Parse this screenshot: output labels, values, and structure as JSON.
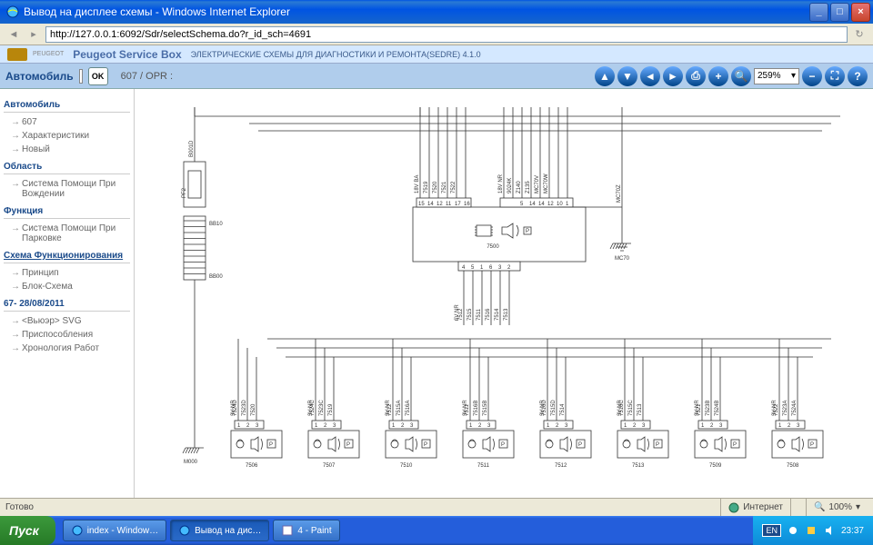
{
  "window": {
    "title": "Вывод на дисплее схемы - Windows Internet Explorer",
    "url": "http://127.0.0.1:6092/Sdr/selectSchema.do?r_id_sch=4691"
  },
  "header": {
    "brand": "Peugeot Service Box",
    "logo_label": "PEUGEOT",
    "subtitle": "ЭЛЕКТРИЧЕСКИЕ СХЕМЫ ДЛЯ ДИАГНОСТИКИ И РЕМОНТА(SEDRE) 4.1.0"
  },
  "toolbar": {
    "car_label": "Автомобиль",
    "ok": "OK",
    "breadcrumb": "607  /  OPR :",
    "zoom": "259%"
  },
  "sidebar": {
    "s1": "Автомобиль",
    "s1_items": [
      "607",
      "Характеристики",
      "Новый"
    ],
    "s2": "Область",
    "s2_items": [
      "Система Помощи При Вождении"
    ],
    "s3": "Функция",
    "s3_items": [
      "Система Помощи При Парковке"
    ],
    "s4": "Схема Функционирования",
    "s4_items": [
      "Принцип",
      "Блок-Схема"
    ],
    "s5": "67- 28/08/2011",
    "s5_items": [
      "<Вьюэр> SVG",
      "Приспособления",
      "Хронология Работ"
    ]
  },
  "diagram": {
    "main_unit": "7500",
    "main_top_pins": [
      "15",
      "14",
      "12",
      "11",
      "17",
      "16",
      "",
      "",
      "5",
      "14",
      "14",
      "12",
      "10",
      "1"
    ],
    "main_top_wires": [
      "18V  BA",
      "7519",
      "7520",
      "7521",
      "7522",
      "",
      "18V  NR",
      "9024K",
      "Z140",
      "Z135",
      "MC70V",
      "MC70W"
    ],
    "main_bot_pins": [
      "4",
      "5",
      "1",
      "6",
      "3",
      "2"
    ],
    "main_bot_wires": [
      "7512",
      "7515",
      "7511",
      "7516",
      "7514",
      "7513"
    ],
    "main_bot_v": "6V  NR",
    "ground_mc70": "MC70",
    "wire_mc70z": "MC70Z",
    "left_block_top": "B001D",
    "left_block_pf2": "PF2",
    "left_bb10": "BB10",
    "left_bb00": "BB00",
    "ground_m000": "M000",
    "sensors": [
      {
        "id": "7506",
        "pins": [
          "1",
          "2",
          "3"
        ],
        "wires": [
          "3V  NR",
          "7524D",
          "7523D",
          "7520"
        ]
      },
      {
        "id": "7507",
        "pins": [
          "1",
          "2",
          "3"
        ],
        "wires": [
          "3V  NR",
          "7524C",
          "7523C",
          "7519"
        ]
      },
      {
        "id": "7510",
        "pins": [
          "1",
          "2",
          "3"
        ],
        "wires": [
          "3V  NR",
          "7512",
          "7515A",
          "7516A"
        ]
      },
      {
        "id": "7511",
        "pins": [
          "1",
          "2",
          "3"
        ],
        "wires": [
          "3V  NR",
          "7511",
          "7516B",
          "7515B"
        ]
      },
      {
        "id": "7512",
        "pins": [
          "1",
          "2",
          "3"
        ],
        "wires": [
          "3V  NR",
          "7516D",
          "7515D",
          "7514"
        ]
      },
      {
        "id": "7513",
        "pins": [
          "1",
          "2",
          "3"
        ],
        "wires": [
          "3V  NR",
          "7516C",
          "7515C",
          "7513"
        ]
      },
      {
        "id": "7509",
        "pins": [
          "1",
          "2",
          "3"
        ],
        "wires": [
          "3V  NR",
          "7521",
          "7523B",
          "7524B"
        ]
      },
      {
        "id": "7508",
        "pins": [
          "1",
          "2",
          "3"
        ],
        "wires": [
          "3V  NR",
          "7522",
          "7523A",
          "7524A"
        ]
      }
    ]
  },
  "status": {
    "ready": "Готово",
    "internet": "Интернет",
    "zoom": "100%"
  },
  "taskbar": {
    "start": "Пуск",
    "items": [
      "index - Window…",
      "Вывод на дис…",
      "4 - Paint"
    ],
    "lang": "EN",
    "time": "23:37"
  }
}
